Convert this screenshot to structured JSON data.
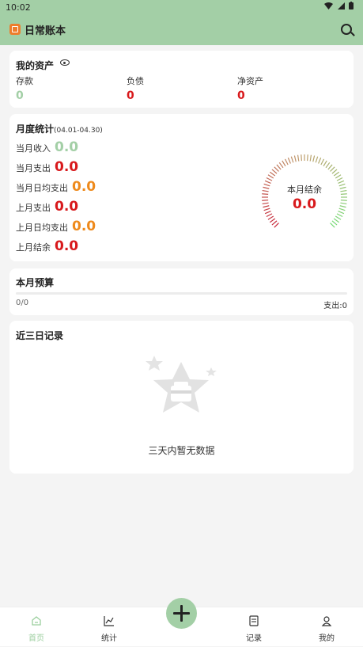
{
  "status": {
    "time": "10:02"
  },
  "app": {
    "title": "日常账本"
  },
  "assets": {
    "title": "我的资产",
    "items": [
      {
        "label": "存款",
        "value": "0",
        "color": "#a3cfa6"
      },
      {
        "label": "负债",
        "value": "0",
        "color": "#d8191c"
      },
      {
        "label": "净资产",
        "value": "0",
        "color": "#d8191c"
      }
    ]
  },
  "monthly": {
    "title": "月度统计",
    "range": "(04.01-04.30)",
    "stats": [
      {
        "label": "当月收入",
        "value": "0.0",
        "color": "#a3cfa6"
      },
      {
        "label": "当月支出",
        "value": "0.0",
        "color": "#d8191c"
      },
      {
        "label": "当月日均支出",
        "value": "0.0",
        "color": "#ee8a1c"
      },
      {
        "label": "上月支出",
        "value": "0.0",
        "color": "#d8191c"
      },
      {
        "label": "上月日均支出",
        "value": "0.0",
        "color": "#ee8a1c"
      },
      {
        "label": "上月结余",
        "value": "0.0",
        "color": "#d8191c"
      }
    ],
    "gauge": {
      "label": "本月结余",
      "value": "0.0"
    }
  },
  "budget": {
    "title": "本月预算",
    "ratio": "0/0",
    "progress_percent": 0,
    "spend": "支出:0"
  },
  "recent": {
    "title": "近三日记录",
    "empty_text": "三天内暂无数据"
  },
  "nav": {
    "items": [
      {
        "label": "首页",
        "icon": "home-icon",
        "active": true
      },
      {
        "label": "统计",
        "icon": "chart-icon",
        "active": false
      },
      {
        "label": "记录",
        "icon": "list-icon",
        "active": false
      },
      {
        "label": "我的",
        "icon": "user-icon",
        "active": false
      }
    ],
    "add_icon": "plus-icon"
  },
  "colors": {
    "accent": "#a3cfa6",
    "expense": "#d8191c",
    "average": "#ee8a1c"
  }
}
